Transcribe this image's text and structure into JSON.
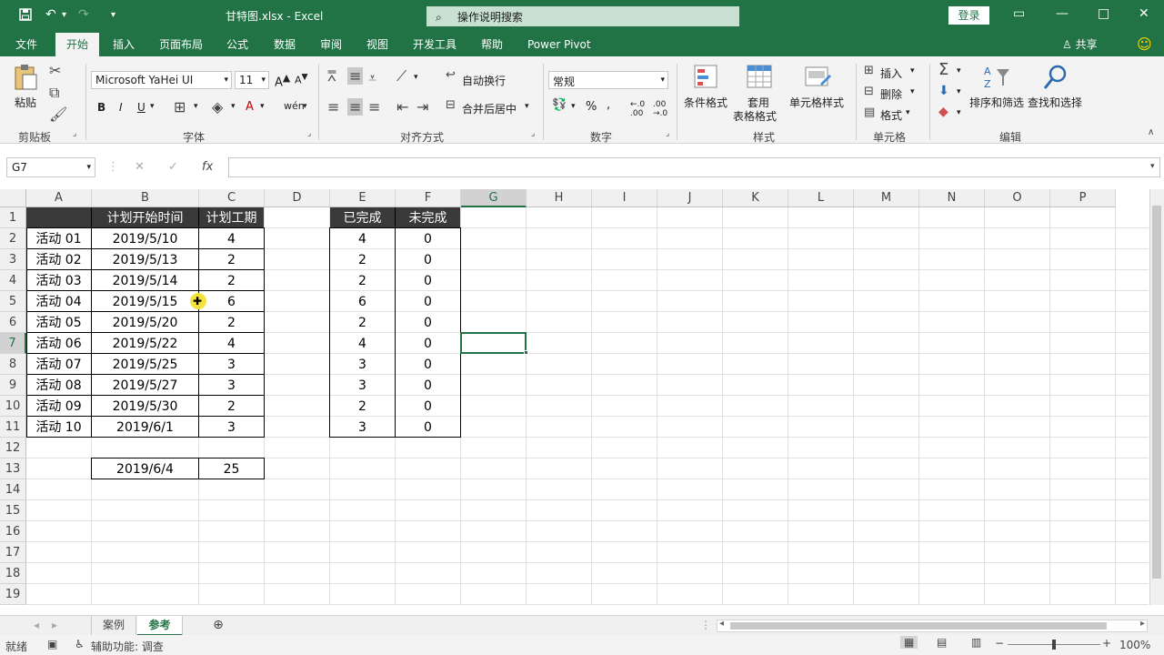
{
  "window": {
    "title": "甘特图.xlsx  -  Excel",
    "search_placeholder": "操作说明搜索",
    "login_label": "登录"
  },
  "tabs": [
    "文件",
    "开始",
    "插入",
    "页面布局",
    "公式",
    "数据",
    "审阅",
    "视图",
    "开发工具",
    "帮助",
    "Power Pivot"
  ],
  "share_label": "共享",
  "ribbon": {
    "clipboard": {
      "paste": "粘贴",
      "label": "剪贴板"
    },
    "font": {
      "name": "Microsoft YaHei UI",
      "size": "11",
      "label": "字体",
      "bold": "B",
      "italic": "I",
      "underline": "U"
    },
    "alignment": {
      "wrap": "自动换行",
      "merge": "合并后居中",
      "label": "对齐方式"
    },
    "number": {
      "format": "常规",
      "label": "数字",
      "percent": "%"
    },
    "styles": {
      "conditional": "条件格式",
      "table_line1": "套用",
      "table_line2": "表格格式",
      "cell_styles": "单元格样式",
      "label": "样式"
    },
    "cells": {
      "insert": "插入",
      "delete": "删除",
      "format": "格式",
      "label": "单元格"
    },
    "editing": {
      "sort": "排序和筛选",
      "find": "查找和选择",
      "label": "编辑"
    }
  },
  "formula_bar": {
    "name_box": "G7",
    "fx": "fx",
    "value": ""
  },
  "columns": [
    "A",
    "B",
    "C",
    "D",
    "E",
    "F",
    "G",
    "H",
    "I",
    "J",
    "K",
    "L",
    "M",
    "N",
    "O",
    "P"
  ],
  "rows": [
    "1",
    "2",
    "3",
    "4",
    "5",
    "6",
    "7",
    "8",
    "9",
    "10",
    "11",
    "12",
    "13",
    "14",
    "15",
    "16",
    "17",
    "18",
    "19"
  ],
  "table1": {
    "headers": [
      "",
      "计划开始时间",
      "计划工期"
    ],
    "rows": [
      [
        "活动 01",
        "2019/5/10",
        "4"
      ],
      [
        "活动 02",
        "2019/5/13",
        "2"
      ],
      [
        "活动 03",
        "2019/5/14",
        "2"
      ],
      [
        "活动 04",
        "2019/5/15",
        "6"
      ],
      [
        "活动 05",
        "2019/5/20",
        "2"
      ],
      [
        "活动 06",
        "2019/5/22",
        "4"
      ],
      [
        "活动 07",
        "2019/5/25",
        "3"
      ],
      [
        "活动 08",
        "2019/5/27",
        "3"
      ],
      [
        "活动 09",
        "2019/5/30",
        "2"
      ],
      [
        "活动 10",
        "2019/6/1",
        "3"
      ]
    ]
  },
  "table2": {
    "headers": [
      "已完成",
      "未完成"
    ],
    "rows": [
      [
        "4",
        "0"
      ],
      [
        "2",
        "0"
      ],
      [
        "2",
        "0"
      ],
      [
        "6",
        "0"
      ],
      [
        "2",
        "0"
      ],
      [
        "4",
        "0"
      ],
      [
        "3",
        "0"
      ],
      [
        "3",
        "0"
      ],
      [
        "2",
        "0"
      ],
      [
        "3",
        "0"
      ]
    ]
  },
  "summary": {
    "date": "2019/6/4",
    "total": "25"
  },
  "sheets": [
    "案例",
    "参考"
  ],
  "active_sheet": "参考",
  "status": {
    "ready": "就绪",
    "accessibility": "辅助功能: 调查",
    "zoom": "100%"
  },
  "colors": {
    "excel_green": "#217346",
    "header_fill": "#3a3a3a"
  }
}
